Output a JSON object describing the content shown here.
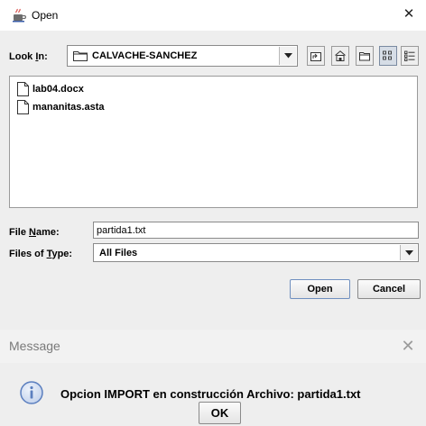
{
  "open_dialog": {
    "title": "Open",
    "look_in": {
      "label_before": "Look ",
      "label_mnemonic": "I",
      "label_after": "n:",
      "value": "CALVACHE-SANCHEZ"
    },
    "files": [
      {
        "name": "lab04.docx"
      },
      {
        "name": "mananitas.asta"
      }
    ],
    "file_name": {
      "label_before": "File ",
      "label_mnemonic": "N",
      "label_after": "ame:",
      "value": "partida1.txt"
    },
    "files_of_type": {
      "label_before": "Files of ",
      "label_mnemonic": "T",
      "label_after": "ype:",
      "value": "All Files"
    },
    "buttons": {
      "open": "Open",
      "cancel": "Cancel"
    }
  },
  "message_dialog": {
    "title": "Message",
    "text": "Opcion IMPORT en construcción Archivo: partida1.txt",
    "ok": "OK"
  },
  "icons": {
    "app": "java-cup-icon",
    "close": "close-icon",
    "folder": "folder-icon",
    "dropdown": "chevron-down-icon",
    "up": "up-one-level-icon",
    "home": "home-icon",
    "new_folder": "new-folder-icon",
    "list": "list-view-icon",
    "details": "details-view-icon",
    "document": "document-icon",
    "info": "info-icon"
  },
  "colors": {
    "dialog_bg": "#eeeeee",
    "info_icon": "#5b7fbf"
  }
}
